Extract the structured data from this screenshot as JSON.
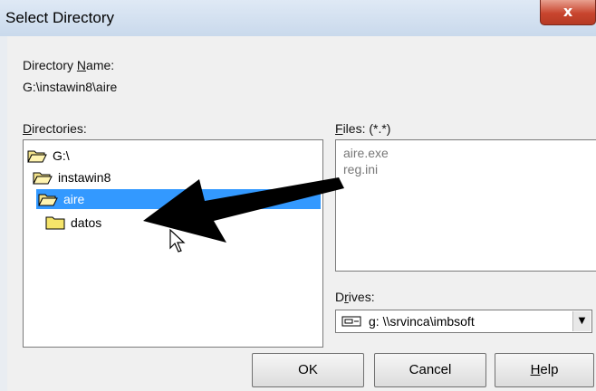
{
  "window": {
    "title": "Select Directory",
    "close_glyph": "x"
  },
  "directory_name": {
    "label_prefix": "Directory ",
    "label_access": "N",
    "label_suffix": "ame:",
    "value": "G:\\instawin8\\aire"
  },
  "directories": {
    "label_access": "D",
    "label_rest": "irectories:",
    "items": [
      {
        "label": "G:\\",
        "icon": "open-folder-icon",
        "selected": false
      },
      {
        "label": "instawin8",
        "icon": "open-folder-icon",
        "selected": false
      },
      {
        "label": "aire",
        "icon": "open-folder-icon",
        "selected": true
      },
      {
        "label": "datos",
        "icon": "closed-folder-icon",
        "selected": false
      }
    ]
  },
  "files": {
    "label_access": "F",
    "label_rest": "iles: (*.*)",
    "items": [
      "aire.exe",
      "reg.ini"
    ]
  },
  "drives": {
    "label_prefix": "D",
    "label_access": "r",
    "label_rest": "ives:",
    "selected": "g: \\\\srvinca\\imbsoft",
    "icon": "network-drive-icon"
  },
  "buttons": {
    "ok": {
      "label": "OK"
    },
    "cancel": {
      "label": "Cancel"
    },
    "help": {
      "label_access": "H",
      "label_rest": "elp"
    }
  },
  "annotation": {
    "icon": "arrow-pointer-annotation",
    "color": "#000000"
  },
  "colors": {
    "selection": "#3399ff",
    "close": "#c8452e"
  }
}
